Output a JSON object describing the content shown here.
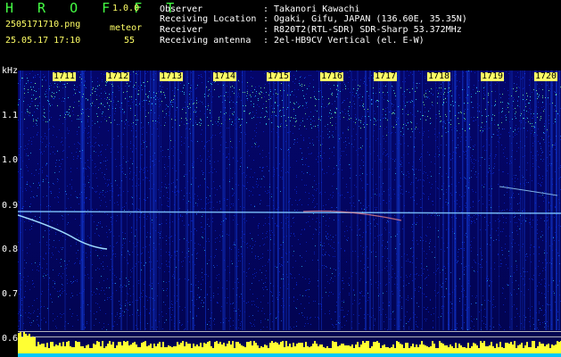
{
  "app": {
    "logo": "H R O F F T",
    "version": "1.0.0",
    "mode": "meteor"
  },
  "file": {
    "name": "2505171710.png",
    "datetime": "25.05.17 17:10",
    "count": "55"
  },
  "info": [
    {
      "label": "Observer",
      "value": ": Takanori Kawachi"
    },
    {
      "label": "Receiving Location",
      "value": ": Ogaki, Gifu, JAPAN (136.60E, 35.35N)"
    },
    {
      "label": "Receiver",
      "value": ": R820T2(RTL-SDR) SDR-Sharp 53.372MHz"
    },
    {
      "label": "Receiving antenna",
      "value": ": 2el-HB9CV Vertical (el. E-W)"
    }
  ],
  "y_axis": {
    "unit": "kHz",
    "ticks": [
      "1.1",
      "1.0",
      "0.9",
      "0.8",
      "0.7",
      "0.6"
    ]
  },
  "time_ticks": [
    "1711",
    "1712",
    "1713",
    "1714",
    "1715",
    "1716",
    "1717",
    "1718",
    "1719",
    "1720"
  ],
  "colors": {
    "background": "#000000",
    "header_text": "#ffffff",
    "accent_yellow": "#ffff66",
    "logo_green": "#44ff44",
    "waterfall_base": "#03055f",
    "signal_trace": "#9fdcff"
  }
}
